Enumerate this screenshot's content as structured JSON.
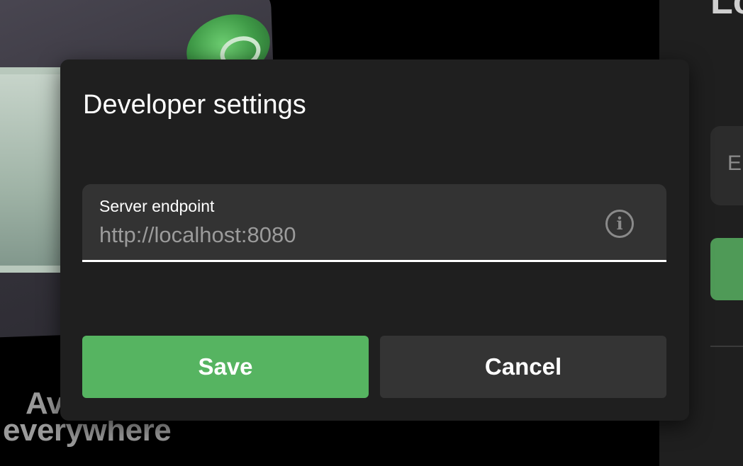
{
  "background": {
    "caption_line1": "Av",
    "caption_line2": "everywhere",
    "right_panel_title": "Lo",
    "right_panel_input_text": "En"
  },
  "dialog": {
    "title": "Developer settings",
    "field": {
      "label": "Server endpoint",
      "placeholder": "http://localhost:8080",
      "value": "",
      "icon": "info-icon"
    },
    "buttons": {
      "save_label": "Save",
      "cancel_label": "Cancel"
    }
  },
  "colors": {
    "primary_green": "#56b461",
    "dialog_bg": "#1f1f1f",
    "field_bg": "#333333",
    "cancel_bg": "#343434"
  }
}
